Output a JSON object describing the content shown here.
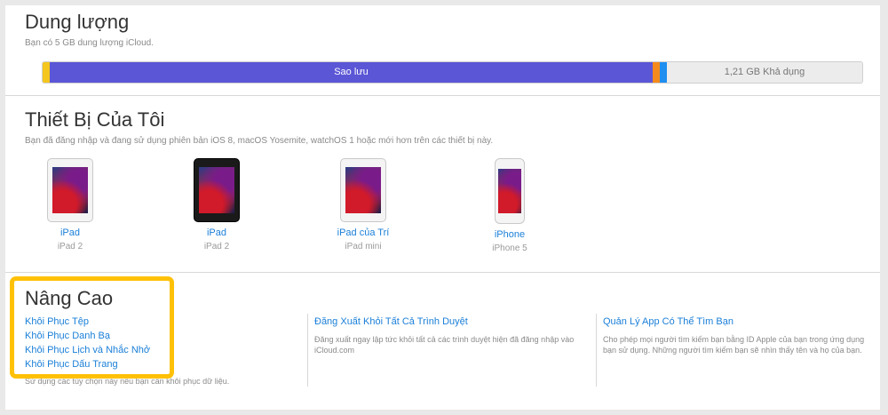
{
  "storage": {
    "title": "Dung lượng",
    "subtitle": "Bạn có 5 GB dung lượng iCloud.",
    "backup_label": "Sao lưu",
    "available_label": "1,21 GB Khả dụng",
    "colors": {
      "yellow": "#f5c61e",
      "backup": "#5b56d6",
      "orange": "#f48a1c",
      "blue": "#1f8ff0",
      "free": "#ececec"
    }
  },
  "devices_section": {
    "title": "Thiết Bị Của Tôi",
    "subtitle": "Bạn đã đăng nhập và đang sử dụng phiên bản iOS 8, macOS Yosemite, watchOS 1 hoặc mới hơn trên các thiết bị này.",
    "devices": [
      {
        "name": "iPad",
        "model": "iPad 2"
      },
      {
        "name": "iPad",
        "model": "iPad 2"
      },
      {
        "name": "iPad của Trí",
        "model": "iPad mini"
      },
      {
        "name": "iPhone",
        "model": "iPhone 5"
      }
    ]
  },
  "advanced": {
    "title": "Nâng Cao",
    "links": [
      "Khôi Phục Tệp",
      "Khôi Phục Danh Bạ",
      "Khôi Phục Lịch và Nhắc Nhở",
      "Khôi Phục Dấu Trang"
    ],
    "hint": "Sử dụng các tùy chọn này nếu bạn cần khôi phục dữ liệu.",
    "col2_title": "Đăng Xuất Khỏi Tất Cả Trình Duyệt",
    "col2_text": "Đăng xuất ngay lập tức khỏi tất cả các trình duyệt hiện đã đăng nhập vào iCloud.com",
    "col3_title": "Quản Lý App Có Thể Tìm Bạn",
    "col3_text": "Cho phép mọi người tìm kiếm bạn bằng ID Apple của bạn trong ứng dụng bạn sử dụng. Những người tìm kiếm bạn sẽ nhìn thấy tên và họ của bạn."
  }
}
